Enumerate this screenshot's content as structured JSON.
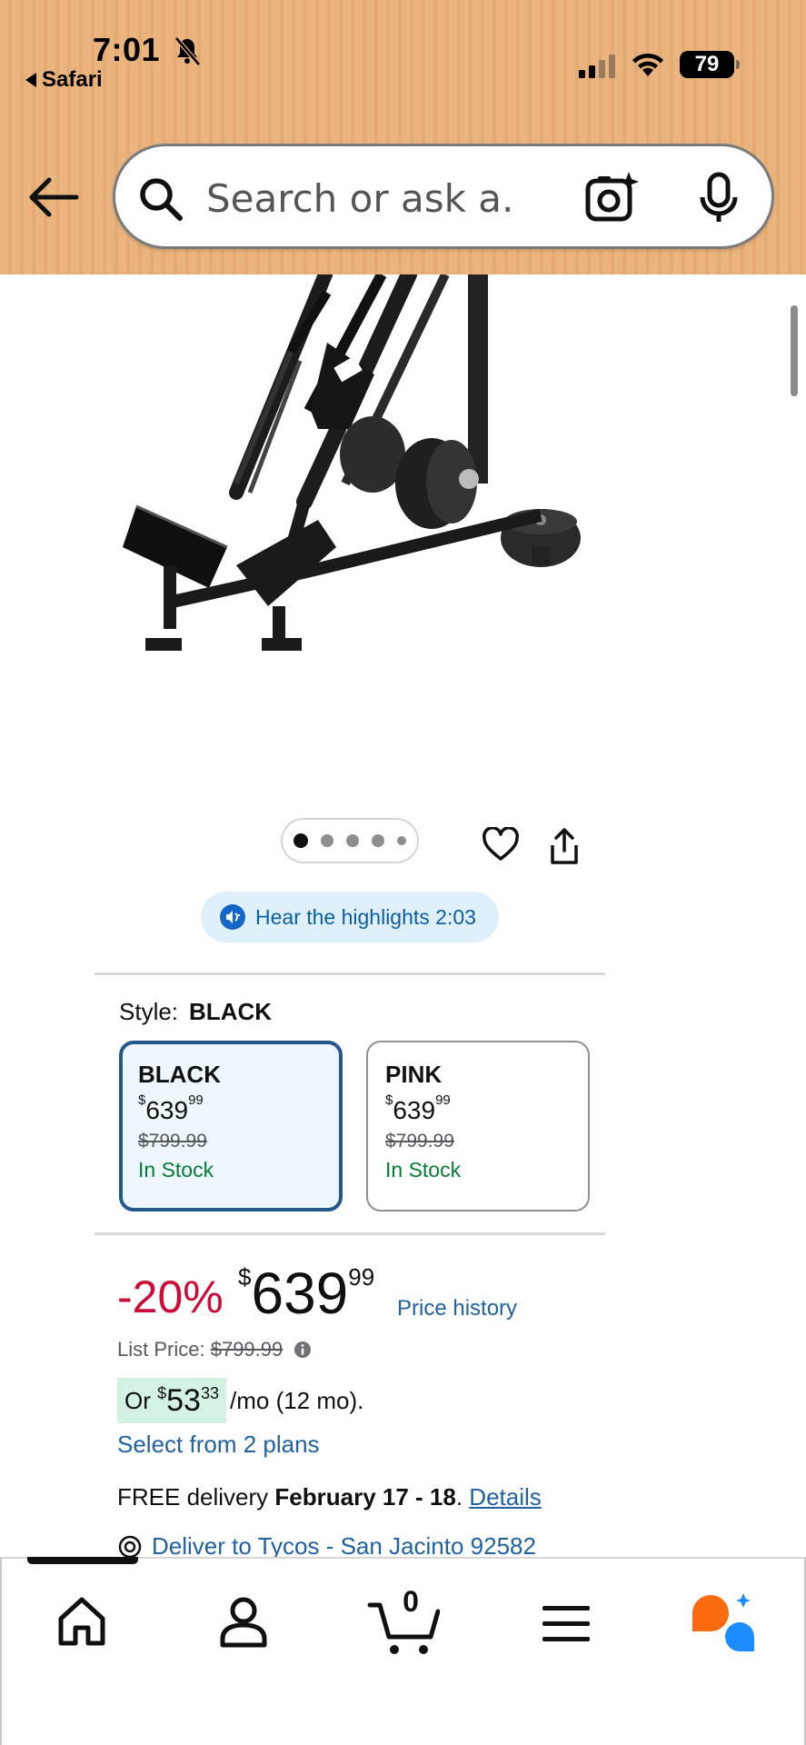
{
  "status_bar": {
    "time": "7:01",
    "back_app": "Safari",
    "battery": "79"
  },
  "search": {
    "placeholder": "Search or ask a..."
  },
  "gallery": {
    "image_count": 5,
    "active_index": 0
  },
  "audio": {
    "label": "Hear the highlights 2:03"
  },
  "style": {
    "label": "Style:",
    "selected": "BLACK",
    "options": [
      {
        "name": "BLACK",
        "price_symbol": "$",
        "price_whole": "639",
        "price_fraction": "99",
        "list_price": "$799.99",
        "stock": "In Stock"
      },
      {
        "name": "PINK",
        "price_symbol": "$",
        "price_whole": "639",
        "price_fraction": "99",
        "list_price": "$799.99",
        "stock": "In Stock"
      }
    ]
  },
  "pricing": {
    "discount": "-20%",
    "symbol": "$",
    "whole": "639",
    "fraction": "99",
    "price_history": "Price history",
    "list_price_label": "List Price:",
    "list_price": "$799.99",
    "monthly_prefix": "Or",
    "monthly_symbol": "$",
    "monthly_whole": "53",
    "monthly_fraction": "33",
    "monthly_suffix": "/mo (12 mo).",
    "plans_link": "Select from 2 plans"
  },
  "delivery": {
    "prefix": "FREE delivery",
    "dates": "February 17 - 18",
    "period": ".",
    "details": "Details",
    "deliver_to": "Deliver to Tycos - San Jacinto 92582"
  },
  "nav": {
    "cart_count": "0",
    "items": [
      "home-icon",
      "account-icon",
      "cart-icon",
      "menu-icon",
      "rufus-ai-icon"
    ]
  },
  "colors": {
    "header_bg": "#eab47f",
    "link": "#2162a1",
    "discount": "#cc0c39",
    "in_stock": "#067d35",
    "selected_border": "#23588c",
    "highlight_bg": "#d3f2e2"
  }
}
